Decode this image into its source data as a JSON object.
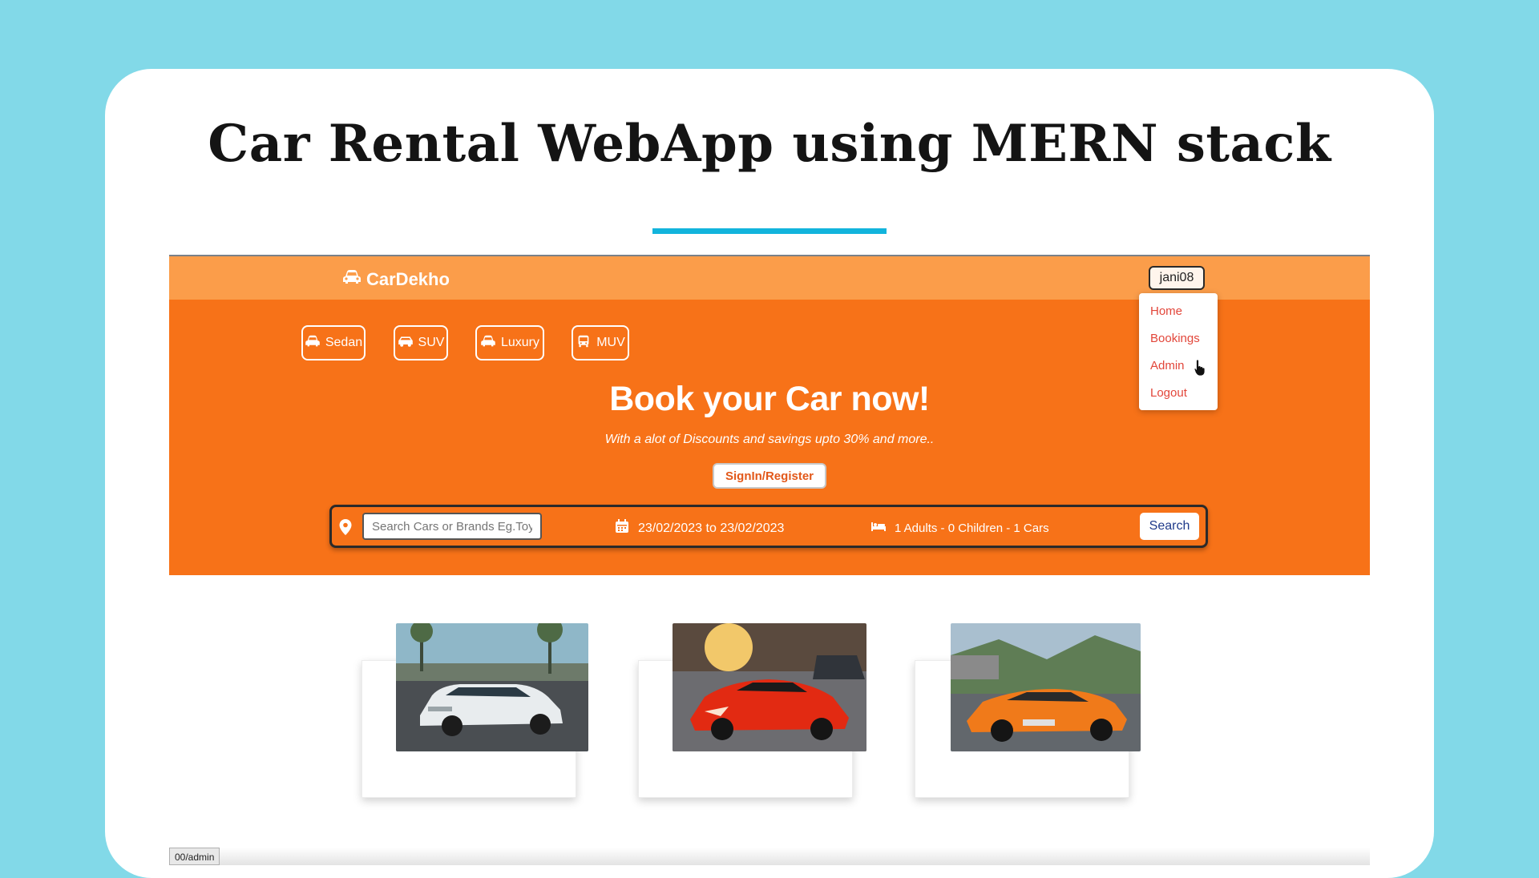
{
  "slide": {
    "title": "Car Rental WebApp using MERN stack",
    "accent_color": "#12b4dc",
    "background_color": "#82d9e8"
  },
  "app": {
    "brand": {
      "name": "CarDekho",
      "icon": "car-icon"
    },
    "user_button": "jani08",
    "menu": {
      "items": [
        {
          "label": "Home"
        },
        {
          "label": "Bookings"
        },
        {
          "label": "Admin"
        },
        {
          "label": "Logout"
        }
      ]
    },
    "categories": [
      {
        "label": "Sedan",
        "icon": "car-icon"
      },
      {
        "label": "SUV",
        "icon": "suv-icon"
      },
      {
        "label": "Luxury",
        "icon": "car-icon"
      },
      {
        "label": "MUV",
        "icon": "bus-icon"
      }
    ],
    "hero": {
      "headline": "Book your Car now!",
      "subline": "With a alot of Discounts and savings upto 30% and more..",
      "signin_label": "SignIn/Register"
    },
    "search": {
      "placeholder": "Search Cars or Brands Eg.Toyota",
      "dates": "23/02/2023 to 23/02/2023",
      "guests": "1 Adults - 0 Children - 1 Cars",
      "button_label": "Search"
    },
    "cars": [
      {
        "alt": "white-sedan-photo",
        "color": "#e8ecee"
      },
      {
        "alt": "red-sports-car-photo",
        "color": "#e22a12"
      },
      {
        "alt": "orange-convertible-photo",
        "color": "#f07a1a"
      }
    ],
    "status_url": "00/admin",
    "colors": {
      "topbar": "#fb9d4a",
      "hero": "#f77218",
      "menu_text": "#e2463a"
    }
  }
}
